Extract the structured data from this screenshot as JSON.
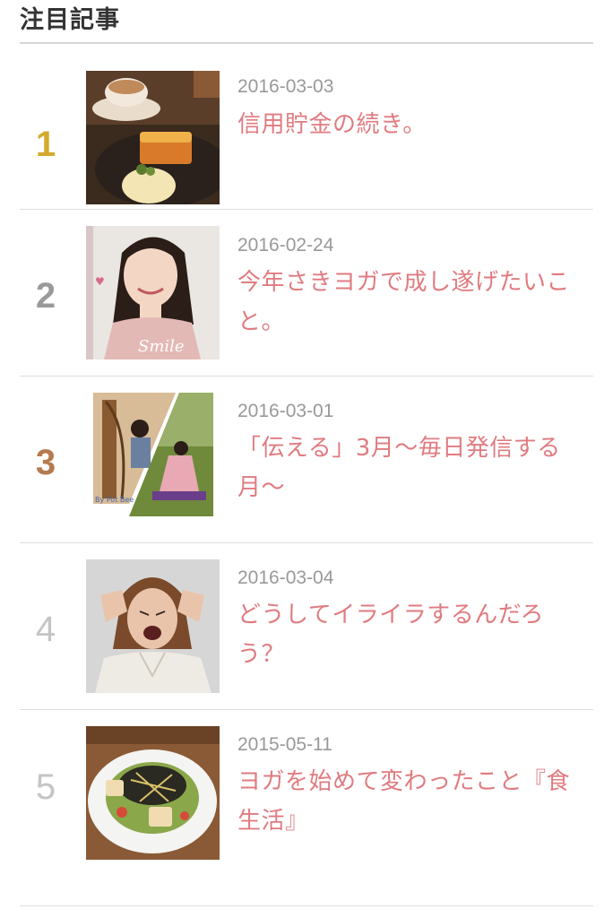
{
  "widget": {
    "title": "注目記事"
  },
  "ranking": [
    {
      "rank": "1",
      "date": "2016-03-03",
      "title": "信用貯金の続き。",
      "color": "#d4aa2e",
      "thumb_icon": "cake-coffee-photo"
    },
    {
      "rank": "2",
      "date": "2016-02-24",
      "title": "今年さきヨガで成し遂げたいこと。",
      "color": "#9a9a9a",
      "thumb_icon": "woman-selfie-photo"
    },
    {
      "rank": "3",
      "date": "2016-03-01",
      "title": "「伝える」3月〜毎日発信する月〜",
      "color": "#b57a4e",
      "thumb_icon": "harp-yoga-collage-photo"
    },
    {
      "rank": "4",
      "date": "2016-03-04",
      "title": "どうしてイライラするんだろう？",
      "color": "#c4c4c4",
      "thumb_icon": "frustrated-woman-photo"
    },
    {
      "rank": "5",
      "date": "2015-05-11",
      "title": "ヨガを始めて変わったこと『食生活』",
      "color": "#c4c4c4",
      "thumb_icon": "salad-plate-photo"
    }
  ]
}
